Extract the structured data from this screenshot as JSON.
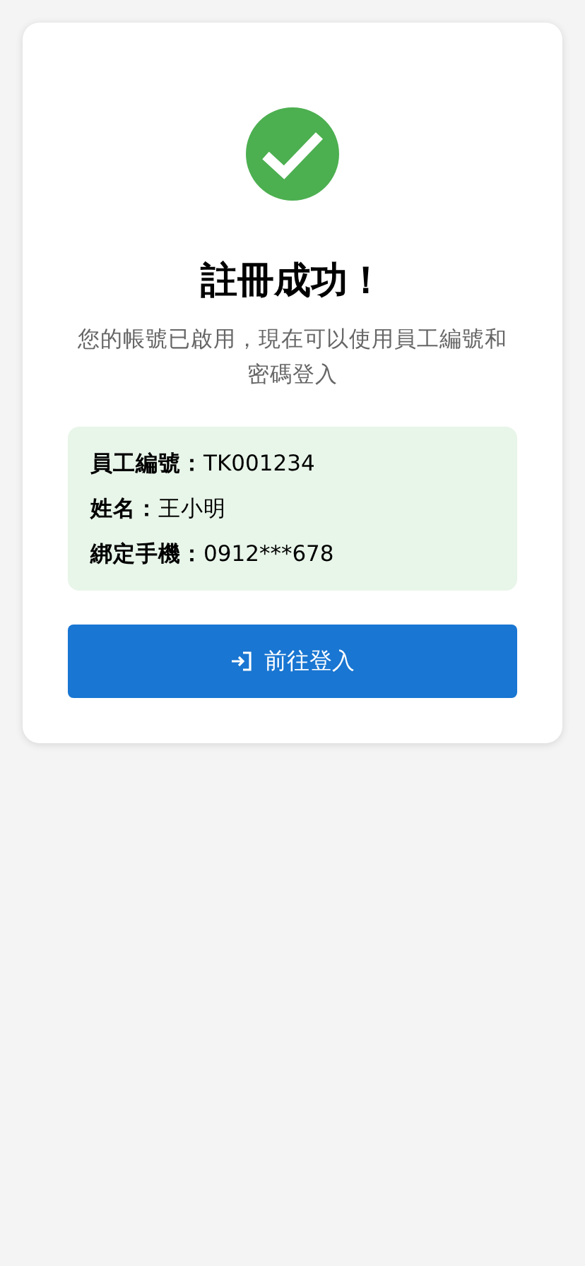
{
  "title": "註冊成功！",
  "message": "您的帳號已啟用，現在可以使用員工編號和密碼登入",
  "details": [
    {
      "label": "員工編號：",
      "value": "TK001234"
    },
    {
      "label": "姓名：",
      "value": "王小明"
    },
    {
      "label": "綁定手機：",
      "value": "0912***678"
    }
  ],
  "button": {
    "label": "前往登入"
  }
}
